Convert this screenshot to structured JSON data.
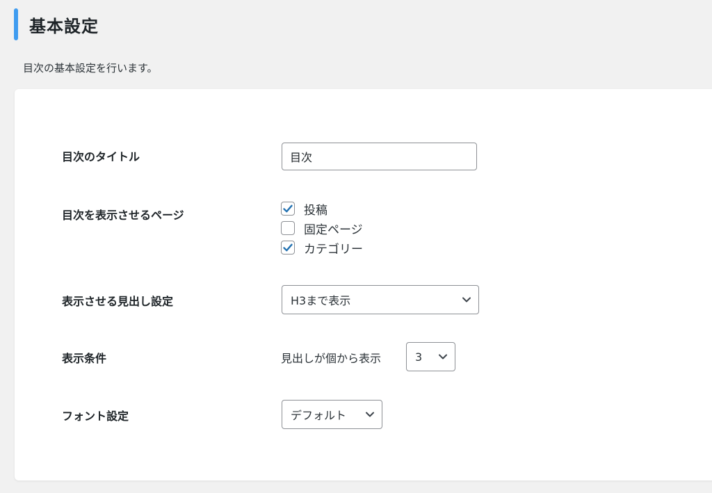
{
  "header": {
    "title": "基本設定",
    "description": "目次の基本設定を行います。",
    "accent_color": "#3f9cf0"
  },
  "settings": {
    "toc_title": {
      "label": "目次のタイトル",
      "value": "目次"
    },
    "display_pages": {
      "label": "目次を表示させるページ",
      "options": [
        {
          "label": "投稿",
          "checked": true
        },
        {
          "label": "固定ページ",
          "checked": false
        },
        {
          "label": "カテゴリー",
          "checked": true
        }
      ]
    },
    "heading_setting": {
      "label": "表示させる見出し設定",
      "selected": "H3まで表示"
    },
    "display_condition": {
      "label": "表示条件",
      "prefix_text": "見出しが個から表示",
      "selected": "3"
    },
    "font_setting": {
      "label": "フォント設定",
      "selected": "デフォルト"
    }
  },
  "icons": {
    "check": "check-icon",
    "chevron": "chevron-down-icon"
  },
  "colors": {
    "checkbox_check": "#2271b1"
  }
}
